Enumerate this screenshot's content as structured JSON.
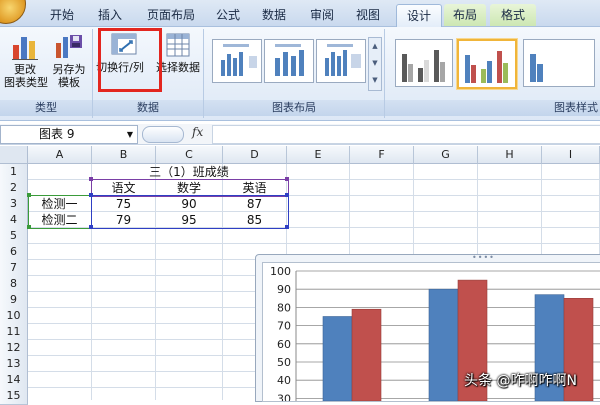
{
  "ribbon": {
    "tabs": [
      {
        "label": "开始"
      },
      {
        "label": "插入"
      },
      {
        "label": "页面布局"
      },
      {
        "label": "公式"
      },
      {
        "label": "数据"
      },
      {
        "label": "审阅"
      },
      {
        "label": "视图"
      },
      {
        "label": "设计"
      },
      {
        "label": "布局"
      },
      {
        "label": "格式"
      }
    ],
    "active_tab": "设计",
    "groups": {
      "type": {
        "label": "类型",
        "buttons": [
          {
            "label": "更改\n图表类型",
            "icon": "chart-type-icon"
          },
          {
            "label": "另存为\n模板",
            "icon": "save-template-icon"
          }
        ]
      },
      "data": {
        "label": "数据",
        "buttons": [
          {
            "label": "切换行/列",
            "icon": "switch-row-col-icon"
          },
          {
            "label": "选择数据",
            "icon": "select-data-icon"
          }
        ]
      },
      "layout": {
        "label": "图表布局"
      },
      "styles": {
        "label": "图表样式"
      }
    }
  },
  "formula_bar": {
    "name_box": "图表 9",
    "fx": "fx",
    "formula": ""
  },
  "sheet": {
    "columns": [
      "A",
      "B",
      "C",
      "D",
      "E",
      "F",
      "G",
      "H",
      "I"
    ],
    "rows": [
      "1",
      "2",
      "3",
      "4",
      "5",
      "6",
      "7",
      "8",
      "9",
      "10",
      "11",
      "12",
      "13",
      "14",
      "15"
    ],
    "title": "三（1）班成绩",
    "headers": [
      "语文",
      "数学",
      "英语"
    ],
    "data_rows": [
      {
        "label": "检测一",
        "values": [
          "75",
          "90",
          "87"
        ]
      },
      {
        "label": "检测二",
        "values": [
          "79",
          "95",
          "85"
        ]
      }
    ]
  },
  "chart_data": {
    "type": "bar",
    "categories": [
      "语文",
      "数学",
      "英语"
    ],
    "series": [
      {
        "name": "检测一",
        "values": [
          75,
          90,
          87
        ],
        "color": "#4f81bd"
      },
      {
        "name": "检测二",
        "values": [
          79,
          95,
          85
        ],
        "color": "#c0504d"
      }
    ],
    "ylim": [
      0,
      100
    ],
    "yticks": [
      "100",
      "90",
      "80",
      "70",
      "60",
      "50",
      "40",
      "30"
    ],
    "title": "",
    "xlabel": "",
    "ylabel": "",
    "grid": true
  },
  "watermark": "头条 @咋啊咋啊N"
}
